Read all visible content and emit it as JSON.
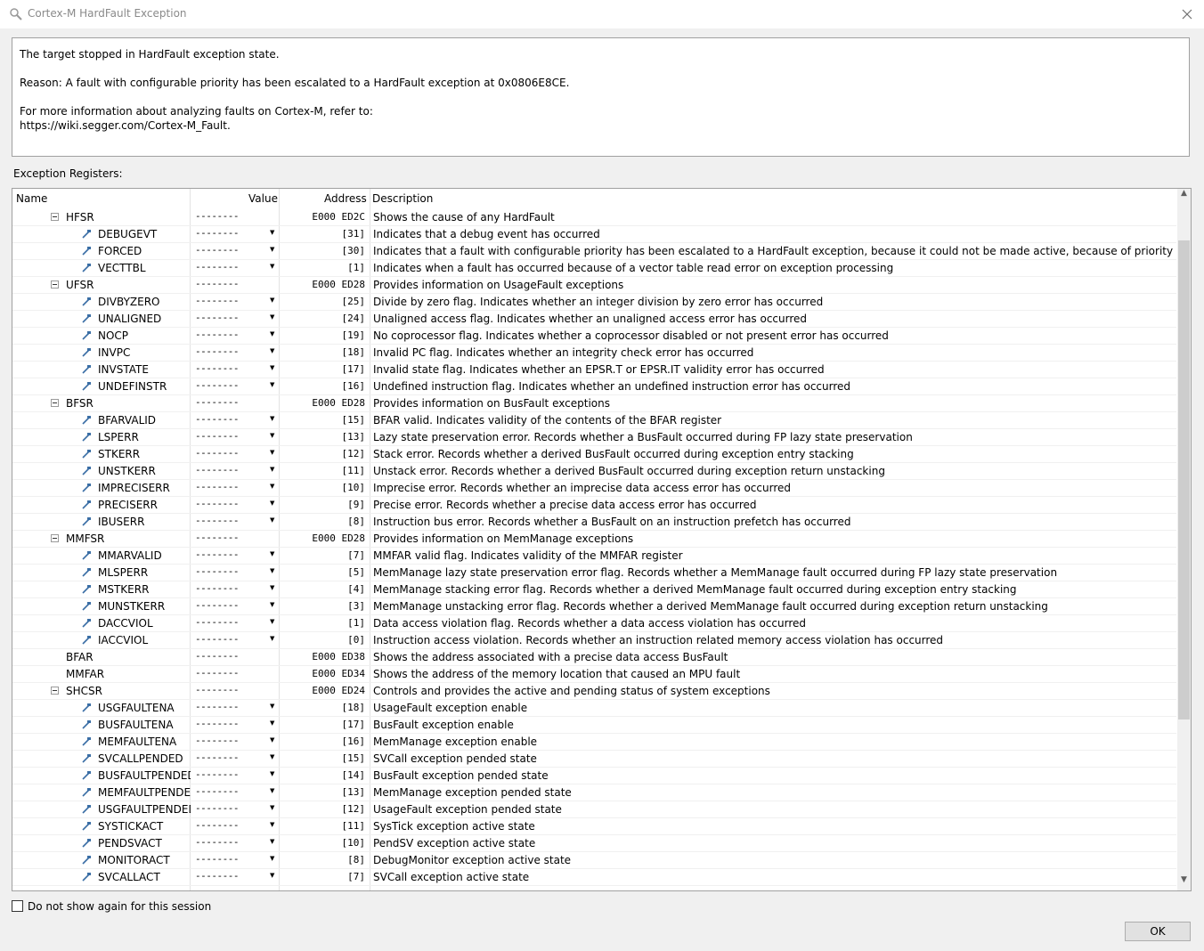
{
  "window": {
    "title": "Cortex-M HardFault Exception",
    "title_icon": "magnifier-icon",
    "close_icon": "close-icon"
  },
  "info": {
    "line1": "The target stopped in HardFault exception state.",
    "line2": "Reason: A fault with configurable priority has been escalated to a HardFault exception at 0x0806E8CE.",
    "line3": "For more information about analyzing faults on Cortex-M, refer to:",
    "line4": "https://wiki.segger.com/Cortex-M_Fault."
  },
  "section_label": "Exception Registers:",
  "columns": {
    "name": "Name",
    "value": "Value",
    "address": "Address",
    "description": "Description"
  },
  "rows": [
    {
      "level": 0,
      "name": "HFSR",
      "value": "--------",
      "address": "E000 ED2C",
      "desc": "Shows the cause of any HardFault",
      "dropdown": false
    },
    {
      "level": 1,
      "name": "DEBUGEVT",
      "value": "--------",
      "address": "[31]",
      "desc": "Indicates that a debug event has occurred",
      "dropdown": true
    },
    {
      "level": 1,
      "name": "FORCED",
      "value": "--------",
      "address": "[30]",
      "desc": "Indicates that a fault with configurable priority has been escalated to a HardFault exception, because it could not be made active, because of priority or becau",
      "dropdown": true
    },
    {
      "level": 1,
      "name": "VECTTBL",
      "value": "--------",
      "address": "[1]",
      "desc": "Indicates when a fault has occurred because of a vector table read error on exception processing",
      "dropdown": true
    },
    {
      "level": 0,
      "name": "UFSR",
      "value": "--------",
      "address": "E000 ED28",
      "desc": "Provides information on UsageFault exceptions",
      "dropdown": false
    },
    {
      "level": 1,
      "name": "DIVBYZERO",
      "value": "--------",
      "address": "[25]",
      "desc": "Divide by zero flag. Indicates whether an integer division by zero error has occurred",
      "dropdown": true
    },
    {
      "level": 1,
      "name": "UNALIGNED",
      "value": "--------",
      "address": "[24]",
      "desc": "Unaligned access flag. Indicates whether an unaligned access error has occurred",
      "dropdown": true
    },
    {
      "level": 1,
      "name": "NOCP",
      "value": "--------",
      "address": "[19]",
      "desc": "No coprocessor flag. Indicates whether a coprocessor disabled or not present error has occurred",
      "dropdown": true
    },
    {
      "level": 1,
      "name": "INVPC",
      "value": "--------",
      "address": "[18]",
      "desc": "Invalid PC flag. Indicates whether an integrity check error has occurred",
      "dropdown": true
    },
    {
      "level": 1,
      "name": "INVSTATE",
      "value": "--------",
      "address": "[17]",
      "desc": "Invalid state flag. Indicates whether an EPSR.T or EPSR.IT validity error has occurred",
      "dropdown": true
    },
    {
      "level": 1,
      "name": "UNDEFINSTR",
      "value": "--------",
      "address": "[16]",
      "desc": "Undefined instruction flag. Indicates whether an undefined instruction error has occurred",
      "dropdown": true
    },
    {
      "level": 0,
      "name": "BFSR",
      "value": "--------",
      "address": "E000 ED28",
      "desc": "Provides information on BusFault exceptions",
      "dropdown": false
    },
    {
      "level": 1,
      "name": "BFARVALID",
      "value": "--------",
      "address": "[15]",
      "desc": "BFAR valid. Indicates validity of the contents of the BFAR register",
      "dropdown": true
    },
    {
      "level": 1,
      "name": "LSPERR",
      "value": "--------",
      "address": "[13]",
      "desc": "Lazy state preservation error. Records whether a BusFault occurred during FP lazy state preservation",
      "dropdown": true
    },
    {
      "level": 1,
      "name": "STKERR",
      "value": "--------",
      "address": "[12]",
      "desc": "Stack error. Records whether a derived BusFault occurred during exception entry stacking",
      "dropdown": true
    },
    {
      "level": 1,
      "name": "UNSTKERR",
      "value": "--------",
      "address": "[11]",
      "desc": "Unstack error. Records whether a derived BusFault occurred during exception return unstacking",
      "dropdown": true
    },
    {
      "level": 1,
      "name": "IMPRECISERR",
      "value": "--------",
      "address": "[10]",
      "desc": "Imprecise error. Records whether an imprecise data access error has occurred",
      "dropdown": true
    },
    {
      "level": 1,
      "name": "PRECISERR",
      "value": "--------",
      "address": "[9]",
      "desc": "Precise error. Records whether a precise data access error has occurred",
      "dropdown": true
    },
    {
      "level": 1,
      "name": "IBUSERR",
      "value": "--------",
      "address": "[8]",
      "desc": "Instruction bus error. Records whether a BusFault on an instruction prefetch has occurred",
      "dropdown": true
    },
    {
      "level": 0,
      "name": "MMFSR",
      "value": "--------",
      "address": "E000 ED28",
      "desc": "Provides information on MemManage exceptions",
      "dropdown": false
    },
    {
      "level": 1,
      "name": "MMARVALID",
      "value": "--------",
      "address": "[7]",
      "desc": "MMFAR valid flag. Indicates validity of the MMFAR register",
      "dropdown": true
    },
    {
      "level": 1,
      "name": "MLSPERR",
      "value": "--------",
      "address": "[5]",
      "desc": "MemManage lazy state preservation error flag. Records whether a MemManage fault occurred during FP lazy state preservation",
      "dropdown": true
    },
    {
      "level": 1,
      "name": "MSTKERR",
      "value": "--------",
      "address": "[4]",
      "desc": "MemManage stacking error flag. Records whether a derived MemManage fault occurred during exception entry stacking",
      "dropdown": true
    },
    {
      "level": 1,
      "name": "MUNSTKERR",
      "value": "--------",
      "address": "[3]",
      "desc": "MemManage unstacking error flag. Records whether a derived MemManage fault occurred during exception return unstacking",
      "dropdown": true
    },
    {
      "level": 1,
      "name": "DACCVIOL",
      "value": "--------",
      "address": "[1]",
      "desc": "Data access violation flag. Records whether a data access violation has occurred",
      "dropdown": true
    },
    {
      "level": 1,
      "name": "IACCVIOL",
      "value": "--------",
      "address": "[0]",
      "desc": "Instruction access violation. Records whether an instruction related memory access violation has occurred",
      "dropdown": true
    },
    {
      "level": 2,
      "name": "BFAR",
      "value": "--------",
      "address": "E000 ED38",
      "desc": "Shows the address associated with a precise data access BusFault",
      "dropdown": false
    },
    {
      "level": 2,
      "name": "MMFAR",
      "value": "--------",
      "address": "E000 ED34",
      "desc": "Shows the address of the memory location that caused an MPU fault",
      "dropdown": false
    },
    {
      "level": 0,
      "name": "SHCSR",
      "value": "--------",
      "address": "E000 ED24",
      "desc": "Controls and provides the active and pending status of system exceptions",
      "dropdown": false
    },
    {
      "level": 1,
      "name": "USGFAULTENA",
      "value": "--------",
      "address": "[18]",
      "desc": "UsageFault exception enable",
      "dropdown": true
    },
    {
      "level": 1,
      "name": "BUSFAULTENA",
      "value": "--------",
      "address": "[17]",
      "desc": "BusFault exception enable",
      "dropdown": true
    },
    {
      "level": 1,
      "name": "MEMFAULTENA",
      "value": "--------",
      "address": "[16]",
      "desc": "MemManage exception enable",
      "dropdown": true
    },
    {
      "level": 1,
      "name": "SVCALLPENDED",
      "value": "--------",
      "address": "[15]",
      "desc": "SVCall exception pended state",
      "dropdown": true
    },
    {
      "level": 1,
      "name": "BUSFAULTPENDED",
      "value": "--------",
      "address": "[14]",
      "desc": "BusFault exception pended state",
      "dropdown": true
    },
    {
      "level": 1,
      "name": "MEMFAULTPENDED",
      "value": "--------",
      "address": "[13]",
      "desc": "MemManage exception pended state",
      "dropdown": true
    },
    {
      "level": 1,
      "name": "USGFAULTPENDED",
      "value": "--------",
      "address": "[12]",
      "desc": "UsageFault exception pended state",
      "dropdown": true
    },
    {
      "level": 1,
      "name": "SYSTICKACT",
      "value": "--------",
      "address": "[11]",
      "desc": "SysTick exception active state",
      "dropdown": true
    },
    {
      "level": 1,
      "name": "PENDSVACT",
      "value": "--------",
      "address": "[10]",
      "desc": "PendSV exception active state",
      "dropdown": true
    },
    {
      "level": 1,
      "name": "MONITORACT",
      "value": "--------",
      "address": "[8]",
      "desc": "DebugMonitor exception active state",
      "dropdown": true
    },
    {
      "level": 1,
      "name": "SVCALLACT",
      "value": "--------",
      "address": "[7]",
      "desc": "SVCall exception active state",
      "dropdown": true
    }
  ],
  "checkbox": {
    "label": "Do not show again for this session",
    "checked": false
  },
  "buttons": {
    "ok": "OK"
  },
  "icons": {
    "expander": "collapse-icon",
    "bit": "bitfield-icon",
    "dropdown": "dropdown-arrow-icon"
  }
}
